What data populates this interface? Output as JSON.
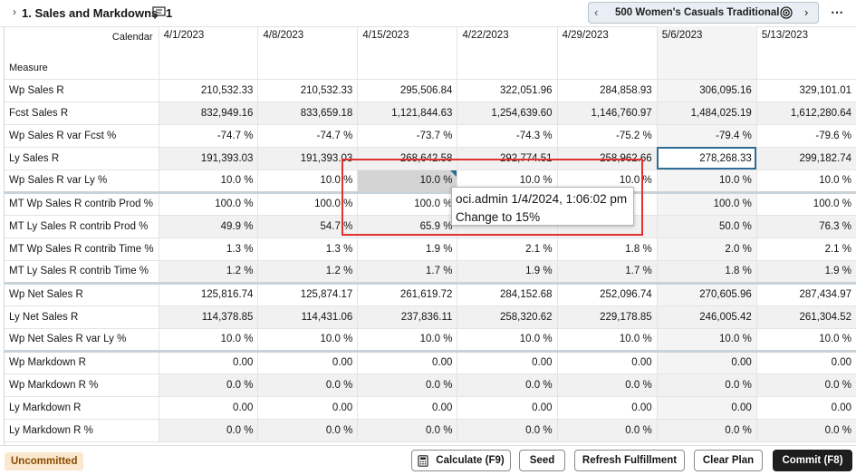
{
  "header": {
    "title": "1. Sales and Markdowns",
    "comment_count": "1",
    "pager_label": "500 Women's Casuals Traditional"
  },
  "grid": {
    "calendar_label": "Calendar",
    "measure_label": "Measure",
    "columns": [
      "4/1/2023",
      "4/8/2023",
      "4/15/2023",
      "4/22/2023",
      "4/29/2023",
      "5/6/2023",
      "5/13/2023"
    ],
    "rows": [
      {
        "label": "Wp Sales R",
        "values": [
          "210,532.33",
          "210,532.33",
          "295,506.84",
          "322,051.96",
          "284,858.93",
          "306,095.16",
          "329,101.01"
        ]
      },
      {
        "label": "Fcst Sales R",
        "values": [
          "832,949.16",
          "833,659.18",
          "1,121,844.63",
          "1,254,639.60",
          "1,146,760.97",
          "1,484,025.19",
          "1,612,280.64"
        ]
      },
      {
        "label": "Wp Sales R var Fcst %",
        "values": [
          "-74.7 %",
          "-74.7 %",
          "-73.7 %",
          "-74.3 %",
          "-75.2 %",
          "-79.4 %",
          "-79.6 %"
        ]
      },
      {
        "label": "Ly Sales R",
        "values": [
          "191,393.03",
          "191,393.03",
          "268,642.58",
          "292,774.51",
          "258,962.66",
          "278,268.33",
          "299,182.74"
        ]
      },
      {
        "label": "Wp Sales R var Ly %",
        "values": [
          "10.0 %",
          "10.0 %",
          "10.0 %",
          "10.0 %",
          "10.0 %",
          "10.0 %",
          "10.0 %"
        ]
      },
      {
        "label": "MT Wp Sales R contrib Prod %",
        "values": [
          "100.0 %",
          "100.0 %",
          "100.0 %",
          "",
          "",
          "100.0 %",
          "100.0 %"
        ]
      },
      {
        "label": "MT Ly Sales R contrib Prod %",
        "values": [
          "49.9 %",
          "54.7 %",
          "65.9 %",
          "",
          "",
          "50.0 %",
          "76.3 %"
        ]
      },
      {
        "label": "MT Wp Sales R contrib Time %",
        "values": [
          "1.3 %",
          "1.3 %",
          "1.9 %",
          "2.1 %",
          "1.8 %",
          "2.0 %",
          "2.1 %"
        ]
      },
      {
        "label": "MT Ly Sales R contrib Time %",
        "values": [
          "1.2 %",
          "1.2 %",
          "1.7 %",
          "1.9 %",
          "1.7 %",
          "1.8 %",
          "1.9 %"
        ]
      },
      {
        "label": "Wp Net Sales R",
        "values": [
          "125,816.74",
          "125,874.17",
          "261,619.72",
          "284,152.68",
          "252,096.74",
          "270,605.96",
          "287,434.97"
        ]
      },
      {
        "label": "Ly Net Sales R",
        "values": [
          "114,378.85",
          "114,431.06",
          "237,836.11",
          "258,320.62",
          "229,178.85",
          "246,005.42",
          "261,304.52"
        ]
      },
      {
        "label": "Wp Net Sales R var Ly %",
        "values": [
          "10.0 %",
          "10.0 %",
          "10.0 %",
          "10.0 %",
          "10.0 %",
          "10.0 %",
          "10.0 %"
        ]
      },
      {
        "label": "Wp Markdown R",
        "values": [
          "0.00",
          "0.00",
          "0.00",
          "0.00",
          "0.00",
          "0.00",
          "0.00"
        ]
      },
      {
        "label": "Wp Markdown R %",
        "values": [
          "0.0 %",
          "0.0 %",
          "0.0 %",
          "0.0 %",
          "0.0 %",
          "0.0 %",
          "0.0 %"
        ]
      },
      {
        "label": "Ly Markdown R",
        "values": [
          "0.00",
          "0.00",
          "0.00",
          "0.00",
          "0.00",
          "0.00",
          "0.00"
        ]
      },
      {
        "label": "Ly Markdown R %",
        "values": [
          "0.0 %",
          "0.0 %",
          "0.0 %",
          "0.0 %",
          "0.0 %",
          "0.0 %",
          "0.0 %"
        ]
      }
    ]
  },
  "tooltip": {
    "line1": "oci.admin 1/4/2024, 1:06:02 pm",
    "line2": "Change to 15%"
  },
  "footer": {
    "status_badge": "Uncommitted",
    "calculate_label": "Calculate (F9)",
    "seed_label": "Seed",
    "refresh_label": "Refresh Fulfillment",
    "clear_label": "Clear Plan",
    "commit_label": "Commit (F8)"
  }
}
